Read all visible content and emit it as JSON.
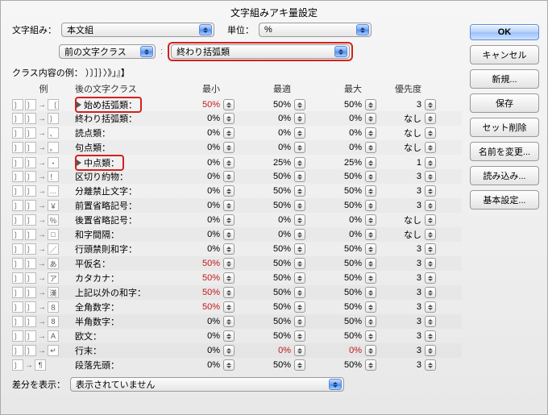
{
  "title": "文字組みアキ量設定",
  "labels": {
    "mojikumi": "文字組み：",
    "unit": "単位：",
    "prev_class": "前の文字クラス",
    "class_example": "クラス内容の例：",
    "example_text": "）〕］｝〉》」』】",
    "ex_col": "例",
    "after_col": "後の文字クラス",
    "min": "最小",
    "opt": "最適",
    "max": "最大",
    "pri": "優先度",
    "diff": "差分を表示："
  },
  "selects": {
    "set": "本文組",
    "unit": "%",
    "prev": "前の文字クラス",
    "target": "終わり括弧類",
    "diff": "表示されていません"
  },
  "buttons": {
    "ok": "OK",
    "cancel": "キャンセル",
    "new": "新規...",
    "save": "保存",
    "delete_set": "セット削除",
    "rename": "名前を変更...",
    "load": "読み込み...",
    "basic": "基本設定..."
  },
  "rows": [
    {
      "g": "〔",
      "name": "始め括弧類：",
      "tri": true,
      "hl": true,
      "min": "50%",
      "minR": true,
      "opt": "50%",
      "max": "50%",
      "pri": "3"
    },
    {
      "g": "〕",
      "name": "終わり括弧類：",
      "min": "0%",
      "opt": "0%",
      "max": "0%",
      "pri": "なし"
    },
    {
      "g": "、",
      "name": "読点類：",
      "min": "0%",
      "opt": "0%",
      "max": "0%",
      "pri": "なし"
    },
    {
      "g": "。",
      "name": "句点類：",
      "min": "0%",
      "opt": "0%",
      "max": "0%",
      "pri": "なし"
    },
    {
      "g": "・",
      "name": "中点類：",
      "tri": true,
      "hl": true,
      "min": "0%",
      "opt": "25%",
      "max": "25%",
      "pri": "1"
    },
    {
      "g": "！",
      "name": "区切り約物：",
      "min": "0%",
      "opt": "50%",
      "max": "50%",
      "pri": "3"
    },
    {
      "g": "…",
      "name": "分離禁止文字：",
      "min": "0%",
      "opt": "50%",
      "max": "50%",
      "pri": "3"
    },
    {
      "g": "￥",
      "name": "前置省略記号：",
      "min": "0%",
      "opt": "50%",
      "max": "50%",
      "pri": "3"
    },
    {
      "g": "％",
      "name": "後置省略記号：",
      "min": "0%",
      "opt": "0%",
      "max": "0%",
      "pri": "なし"
    },
    {
      "g": "□",
      "name": "和字間隔：",
      "min": "0%",
      "opt": "0%",
      "max": "0%",
      "pri": "なし"
    },
    {
      "g": "／",
      "name": "行頭禁則和字：",
      "min": "0%",
      "opt": "50%",
      "max": "50%",
      "pri": "3"
    },
    {
      "g": "あ",
      "name": "平仮名：",
      "min": "50%",
      "minR": true,
      "opt": "50%",
      "max": "50%",
      "pri": "3"
    },
    {
      "g": "ア",
      "name": "カタカナ：",
      "min": "50%",
      "minR": true,
      "opt": "50%",
      "max": "50%",
      "pri": "3"
    },
    {
      "g": "漢",
      "name": "上記以外の和字：",
      "min": "50%",
      "minR": true,
      "opt": "50%",
      "max": "50%",
      "pri": "3"
    },
    {
      "g": "８",
      "name": "全角数字：",
      "min": "50%",
      "minR": true,
      "opt": "50%",
      "max": "50%",
      "pri": "3"
    },
    {
      "g": "8",
      "name": "半角数字：",
      "min": "0%",
      "opt": "50%",
      "max": "50%",
      "pri": "3"
    },
    {
      "g": "A",
      "name": "欧文：",
      "min": "0%",
      "opt": "50%",
      "max": "50%",
      "pri": "3"
    },
    {
      "g": "↵",
      "name": "行末：",
      "min": "0%",
      "opt": "0%",
      "optR": true,
      "max": "0%",
      "maxR": true,
      "pri": "3"
    },
    {
      "g": "¶",
      "name": "段落先頭：",
      "arrow": false,
      "min": "0%",
      "opt": "50%",
      "max": "50%",
      "pri": "3"
    }
  ]
}
